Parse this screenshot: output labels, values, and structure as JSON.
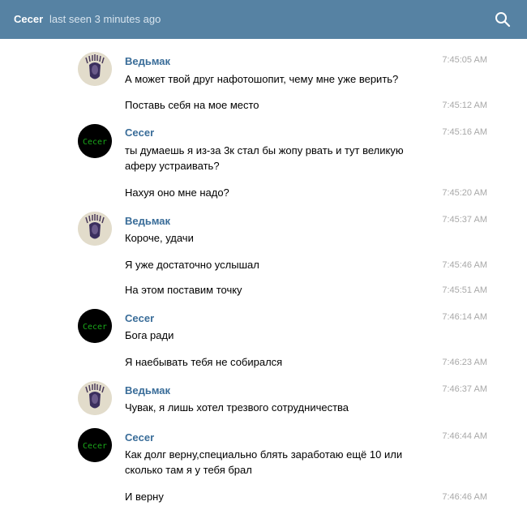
{
  "header": {
    "contact_name": "Cecer",
    "last_seen": "last seen 3 minutes ago",
    "search_icon": "search-icon",
    "bg_color": "#5682a3"
  },
  "messages": [
    {
      "author": "Ведьмак",
      "text": "А может твой друг нафотошопит, чему мне уже верить?",
      "time": "7:45:05 AM"
    },
    {
      "text": "Поставь себя на мое место",
      "time": "7:45:12 AM"
    },
    {
      "author": "Cecer",
      "text": "ты думаешь я из-за 3к стал бы жопу рвать и тут великую аферу устраивать?",
      "time": "7:45:16 AM"
    },
    {
      "text": "Нахуя оно мне надо?",
      "time": "7:45:20 AM"
    },
    {
      "author": "Ведьмак",
      "text": "Короче, удачи",
      "time": "7:45:37 AM"
    },
    {
      "text": "Я уже достаточно услышал",
      "time": "7:45:46 AM"
    },
    {
      "text": "На этом поставим точку",
      "time": "7:45:51 AM"
    },
    {
      "author": "Cecer",
      "text": "Бога ради",
      "time": "7:46:14 AM"
    },
    {
      "text": "Я наебывать тебя не собирался",
      "time": "7:46:23 AM"
    },
    {
      "author": "Ведьмак",
      "text": "Чувак, я лишь хотел трезвого сотрудничества",
      "time": "7:46:37 AM"
    },
    {
      "author": "Cecer",
      "text": "Как долг верну,специально блять заработаю ещё 10 или сколько там я у тебя брал",
      "time": "7:46:44 AM"
    },
    {
      "text": "И верну",
      "time": "7:46:46 AM"
    }
  ],
  "avatars": {
    "vedmak": "native-headdress-avatar",
    "cecer": "Cecer"
  }
}
